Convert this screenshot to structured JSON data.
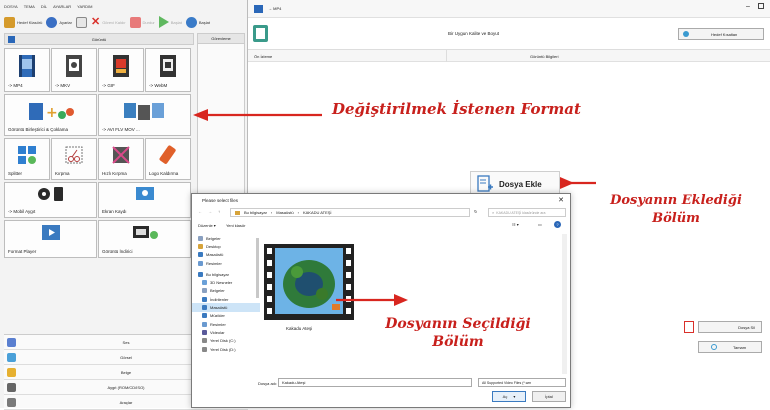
{
  "left_app": {
    "menu": [
      "DOSYA",
      "TEMA",
      "DİL",
      "AYARLAR",
      "YARDIM"
    ],
    "toolbar": [
      {
        "label": "Hedef Klasörü",
        "icon": "folder-icon",
        "color": "#d59a2b"
      },
      {
        "label": "Ayarlar",
        "icon": "settings-icon",
        "color": "#3a6fc4"
      },
      {
        "label": "",
        "icon": "list-icon",
        "color": "#8a8a8a"
      },
      {
        "label": "Görevi Kaldır",
        "icon": "remove-icon",
        "color": "#d9302a"
      },
      {
        "label": "Durdur",
        "icon": "stop-icon",
        "color": "#e87a7a"
      },
      {
        "label": "Başlat",
        "icon": "play-icon",
        "color": "#5fb85f"
      },
      {
        "label": "Başlat",
        "icon": "globe-icon",
        "color": "#3a7bc8"
      }
    ],
    "panel_header": "Görüntü",
    "queue_header": "Görevleme",
    "tiles": [
      {
        "label": "-> MP4",
        "name": "tile-mp4",
        "color": "#2f6bb8"
      },
      {
        "label": "-> MKV",
        "name": "tile-mkv",
        "color": "#444444"
      },
      {
        "label": "-> GIF",
        "name": "tile-gif",
        "color": "#d93a2a"
      },
      {
        "label": "-> WebM",
        "name": "tile-webm",
        "color": "#333333"
      },
      {
        "label": "Görüntü Birleştirici & Çoklama",
        "name": "tile-video-joiner",
        "color": "#2f8fd0"
      },
      {
        "label": "-> AVI FLV MOV ...",
        "name": "tile-avi-flv-mov",
        "color": "#3b7fbf"
      },
      {
        "label": "Splitter",
        "name": "tile-splitter",
        "color": "#2f7fd0"
      },
      {
        "label": "Kırpma",
        "name": "tile-crop",
        "color": "#b33a3a"
      },
      {
        "label": "Hızlı Kırpma",
        "name": "tile-quick-crop",
        "color": "#8a2a8a"
      },
      {
        "label": "Logo Kaldırma",
        "name": "tile-logo-remove",
        "color": "#e0602a"
      },
      {
        "label": "-> Mobil Aygıt",
        "name": "tile-mobile-device",
        "color": "#2a2a2a"
      },
      {
        "label": "Ekran Kaydı",
        "name": "tile-screen-record",
        "color": "#3a8ad0"
      },
      {
        "label": "Format Player",
        "name": "tile-format-player",
        "color": "#3a7ac0"
      },
      {
        "label": "Görüntü İndirici",
        "name": "tile-video-downloader",
        "color": "#2a2a2a"
      }
    ],
    "side_list": [
      {
        "label": "Ses",
        "icon": "audio-icon",
        "color": "#5a7fd0"
      },
      {
        "label": "Görsel",
        "icon": "image-icon",
        "color": "#4aa0d8"
      },
      {
        "label": "Belge",
        "icon": "document-icon",
        "color": "#e6b030"
      },
      {
        "label": "Aygıt (ROM/CD/ISO)",
        "icon": "disc-icon",
        "color": "#666666"
      },
      {
        "label": "Araçlar",
        "icon": "tools-icon",
        "color": "#7a7a7a"
      }
    ]
  },
  "right_app": {
    "title": "→ MP4",
    "subtitle": "Bir Uygun Kalite ve Boyut",
    "output_folder_button": "Hedef Kısaltan",
    "columns": [
      "Ön İzleme",
      "Görüntü Bilgileri"
    ],
    "add_file_button": "Dosya Ekle",
    "clear_list_button": "Dosya Sil",
    "ok_button": "Tamam"
  },
  "dialog": {
    "title": "Please select files",
    "breadcrumb": [
      "Bu bilgisayar",
      "Masaüstü",
      "KAKADU ATEŞİ"
    ],
    "search_placeholder": "KAKADU ATEŞİ klasöründe ara",
    "organize_label": "Düzenle ▾",
    "new_folder_label": "Yeni klasör",
    "sidebar": [
      "Belgeler",
      "Desktop",
      "Masaüstü",
      "Resimler",
      "Bu bilgisayar",
      "3D Nesneler",
      "Belgeler",
      "İndirilenler",
      "Masaüstü",
      "Müzikler",
      "Resimler",
      "Videolar",
      "Yerel Disk (C:)",
      "Yerel Disk (D:)"
    ],
    "file_name": "Kakadu Ateşi",
    "filename_label": "Dosya adı:",
    "filename_value": "Kakadu Ateşi",
    "filetype_value": "All Supported Video Files (*.wm",
    "open_button": "Aç",
    "cancel_button": "İptal"
  },
  "annotations": {
    "format": "Değiştirilmek İstenen Format",
    "added": "Dosyanın Eklediği Bölüm",
    "selected": "Dosyanın Seçildiği Bölüm"
  },
  "accent_red": "#d8261f"
}
